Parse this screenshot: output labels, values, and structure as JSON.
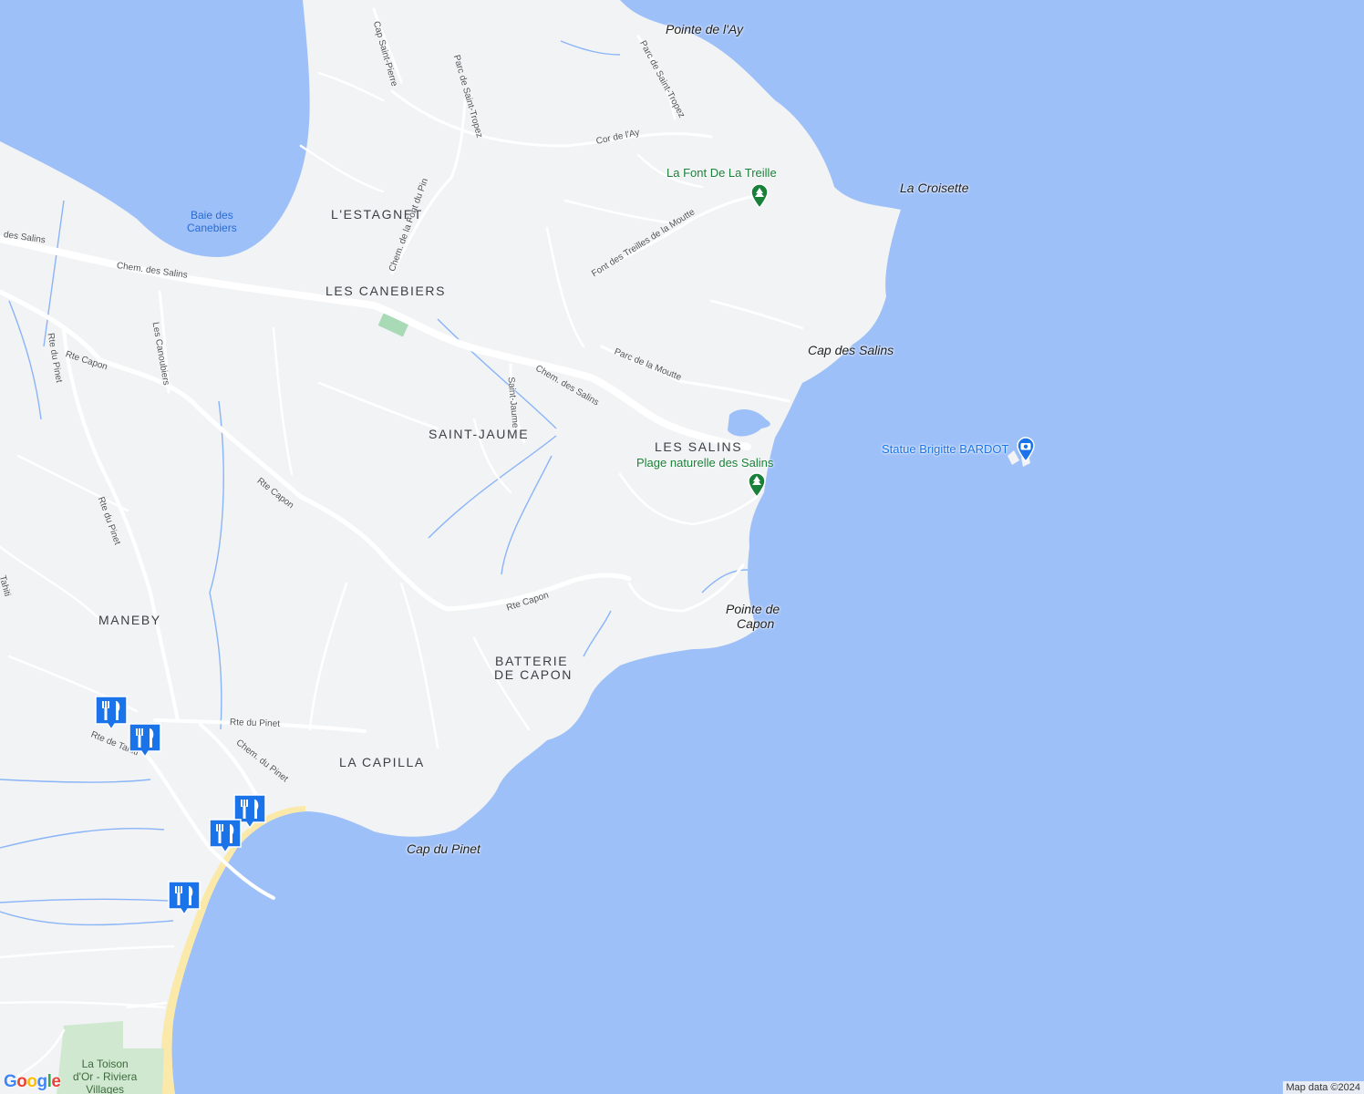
{
  "map": {
    "colors": {
      "land": "#f1f3f4",
      "water": "#9ec0f9",
      "road": "#ffffff",
      "stream": "#8ab4f8",
      "sand": "#fbe9a9",
      "park": "#cfe8cf"
    },
    "district_labels": [
      {
        "text": "L'ESTAGNET"
      },
      {
        "text": "LES CANEBIERS"
      },
      {
        "text": "SAINT-JAUME"
      },
      {
        "text": "LES SALINS"
      },
      {
        "text": "MANEBY"
      },
      {
        "text": "BATTERIE"
      },
      {
        "text": "DE CAPON"
      },
      {
        "text": "LA CAPILLA"
      }
    ],
    "coastal_labels": [
      {
        "text": "Pointe de l'Ay"
      },
      {
        "text": "La Croisette"
      },
      {
        "text": "Cap des Salins"
      },
      {
        "text": "Pointe de"
      },
      {
        "text": "Capon"
      },
      {
        "text": "Cap du Pinet"
      }
    ],
    "water_labels": [
      {
        "text": "Baie des"
      },
      {
        "text": "Canebiers"
      }
    ],
    "street_labels": [
      {
        "text": "Chem. des Salins"
      },
      {
        "text": "Chem. des Salins"
      },
      {
        "text": "des Salins"
      },
      {
        "text": "Rte Capon"
      },
      {
        "text": "Rte Capon"
      },
      {
        "text": "Rte Capon"
      },
      {
        "text": "Rte du Pinet"
      },
      {
        "text": "Rte du Pinet"
      },
      {
        "text": "Rte du Pinet"
      },
      {
        "text": "Chem. du Pinet"
      },
      {
        "text": "Rte de Tahiti"
      },
      {
        "text": "Tahiti"
      },
      {
        "text": "Les Canoubiers"
      },
      {
        "text": "Chem. de la Font du Pin"
      },
      {
        "text": "Parc de Saint-Tropez"
      },
      {
        "text": "Parc de Saint-Tropez"
      },
      {
        "text": "Cap Saint-Pierre"
      },
      {
        "text": "Cor de l'Ay"
      },
      {
        "text": "Font des Treilles de la Moutte"
      },
      {
        "text": "Parc de la Moutte"
      },
      {
        "text": "Saint-Jaume"
      }
    ],
    "pois": {
      "font_treille": {
        "name": "La Font De La Treille",
        "icon": "park-pin-icon",
        "color": "#188038"
      },
      "plage_salins": {
        "name": "Plage naturelle des Salins",
        "icon": "park-pin-icon",
        "color": "#188038"
      },
      "bardot": {
        "name": "Statue Brigitte BARDOT",
        "icon": "camera-pin-icon",
        "color": "#1a73e8"
      },
      "toison": {
        "lines": [
          "La Toison",
          "d'Or - Riviera",
          "Villages"
        ]
      }
    },
    "restaurant_markers": [
      {
        "icon": "restaurant-icon"
      },
      {
        "icon": "restaurant-icon"
      },
      {
        "icon": "restaurant-icon"
      },
      {
        "icon": "restaurant-icon"
      },
      {
        "icon": "restaurant-icon"
      }
    ],
    "logo": {
      "text": "Google"
    },
    "attribution": {
      "text": "Map data ©2024"
    }
  }
}
